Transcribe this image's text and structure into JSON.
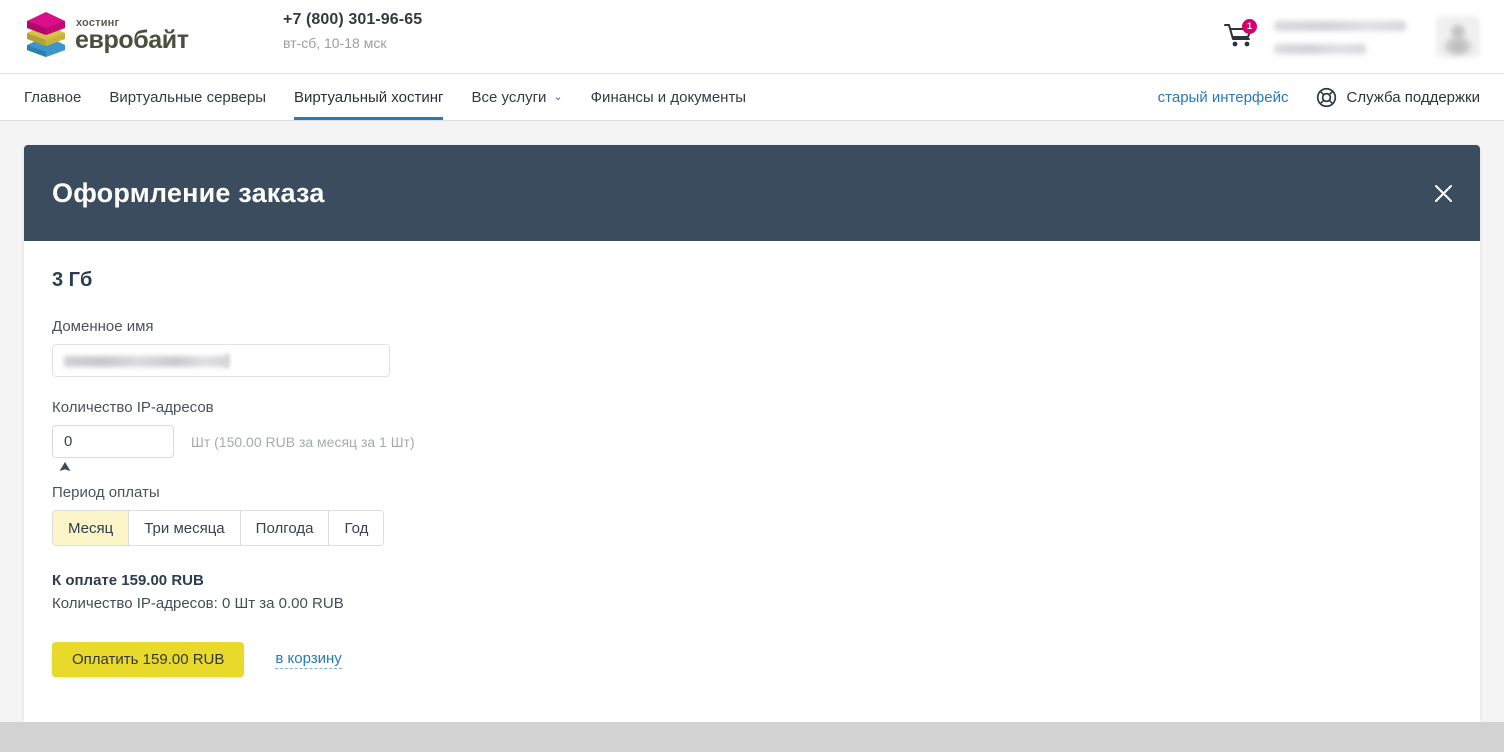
{
  "header": {
    "logo": {
      "small_text": "хостинг",
      "big_text": "евробайт",
      "icon": "stacked-slabs-logo",
      "colors": {
        "top": "#cf0b7d",
        "middle": "#c9b43a",
        "bottom": "#3d96c9"
      }
    },
    "phone": "+7 (800) 301-96-65",
    "hours": "вт-сб, 10-18 мск",
    "cart": {
      "icon": "shopping-cart-icon",
      "badge_count": "1",
      "badge_color": "#d4006e"
    },
    "account": {
      "email_redacted": true,
      "balance_redacted": true
    },
    "avatar": {
      "icon": "user-avatar",
      "redacted": true
    }
  },
  "nav": {
    "items": [
      {
        "label": "Главное",
        "active": false,
        "has_chevron": false
      },
      {
        "label": "Виртуальные серверы",
        "active": false,
        "has_chevron": false
      },
      {
        "label": "Виртуальный хостинг",
        "active": true,
        "has_chevron": false
      },
      {
        "label": "Все услуги",
        "active": false,
        "has_chevron": true
      },
      {
        "label": "Финансы и документы",
        "active": false,
        "has_chevron": false
      }
    ],
    "old_interface_label": "старый интерфейс",
    "support_label": "Служба поддержки",
    "support_icon": "lifebuoy-icon",
    "active_underline_color": "#2779bd",
    "link_color": "#2779bd"
  },
  "modal": {
    "title": "Оформление заказа",
    "header_bg": "#3b4c5e",
    "close_icon": "close-icon",
    "plan_title": "3 Гб",
    "domain": {
      "label": "Доменное имя",
      "value": "",
      "placeholder": "",
      "redacted": true
    },
    "ip_count": {
      "label": "Количество IP-адресов",
      "value": "0",
      "hint": "Шт (150.00 RUB за месяц за 1 Шт)"
    },
    "period": {
      "label": "Период оплаты",
      "options": [
        {
          "label": "Месяц",
          "selected": true
        },
        {
          "label": "Три месяца",
          "selected": false
        },
        {
          "label": "Полгода",
          "selected": false
        },
        {
          "label": "Год",
          "selected": false
        }
      ],
      "selected_bg": "#fcf5c7"
    },
    "summary": {
      "total_label": "К оплате 159.00 RUB",
      "detail_label": "Количество IP-адресов: 0 Шт за 0.00 RUB"
    },
    "actions": {
      "pay_label": "Оплатить 159.00 RUB",
      "pay_color": "#e8d92a",
      "cart_link_label": "в корзину"
    }
  }
}
